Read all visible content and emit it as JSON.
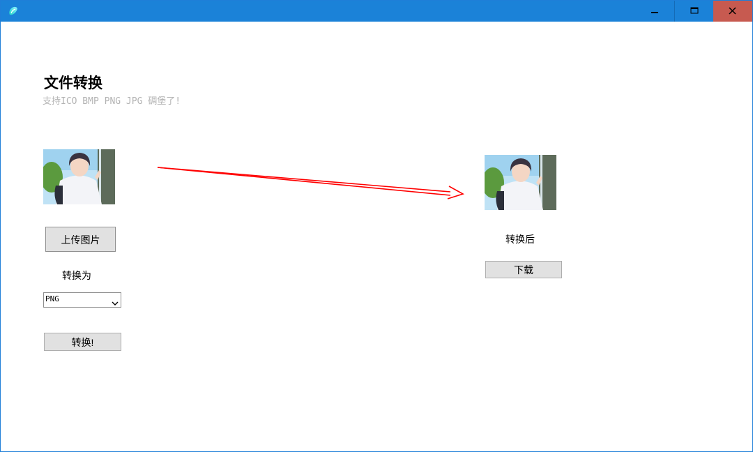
{
  "window": {
    "accent_color": "#1b82d8",
    "close_color": "#c75a50",
    "icons": {
      "app": "app-icon",
      "minimize": "minimize-icon",
      "maximize": "maximize-icon",
      "close": "close-icon"
    }
  },
  "page": {
    "title": "文件转换",
    "subtitle": "支持ICO BMP PNG JPG 碉堡了!"
  },
  "source": {
    "image_name": "uploaded-image-preview",
    "upload_label": "上传图片",
    "convert_to_label": "转换为",
    "format_selected": "PNG",
    "convert_label": "转换!"
  },
  "arrow": {
    "color": "#ff0000",
    "icon": "arrow-right-icon"
  },
  "result": {
    "image_name": "converted-image-preview",
    "label": "转换后",
    "download_label": "下载"
  }
}
